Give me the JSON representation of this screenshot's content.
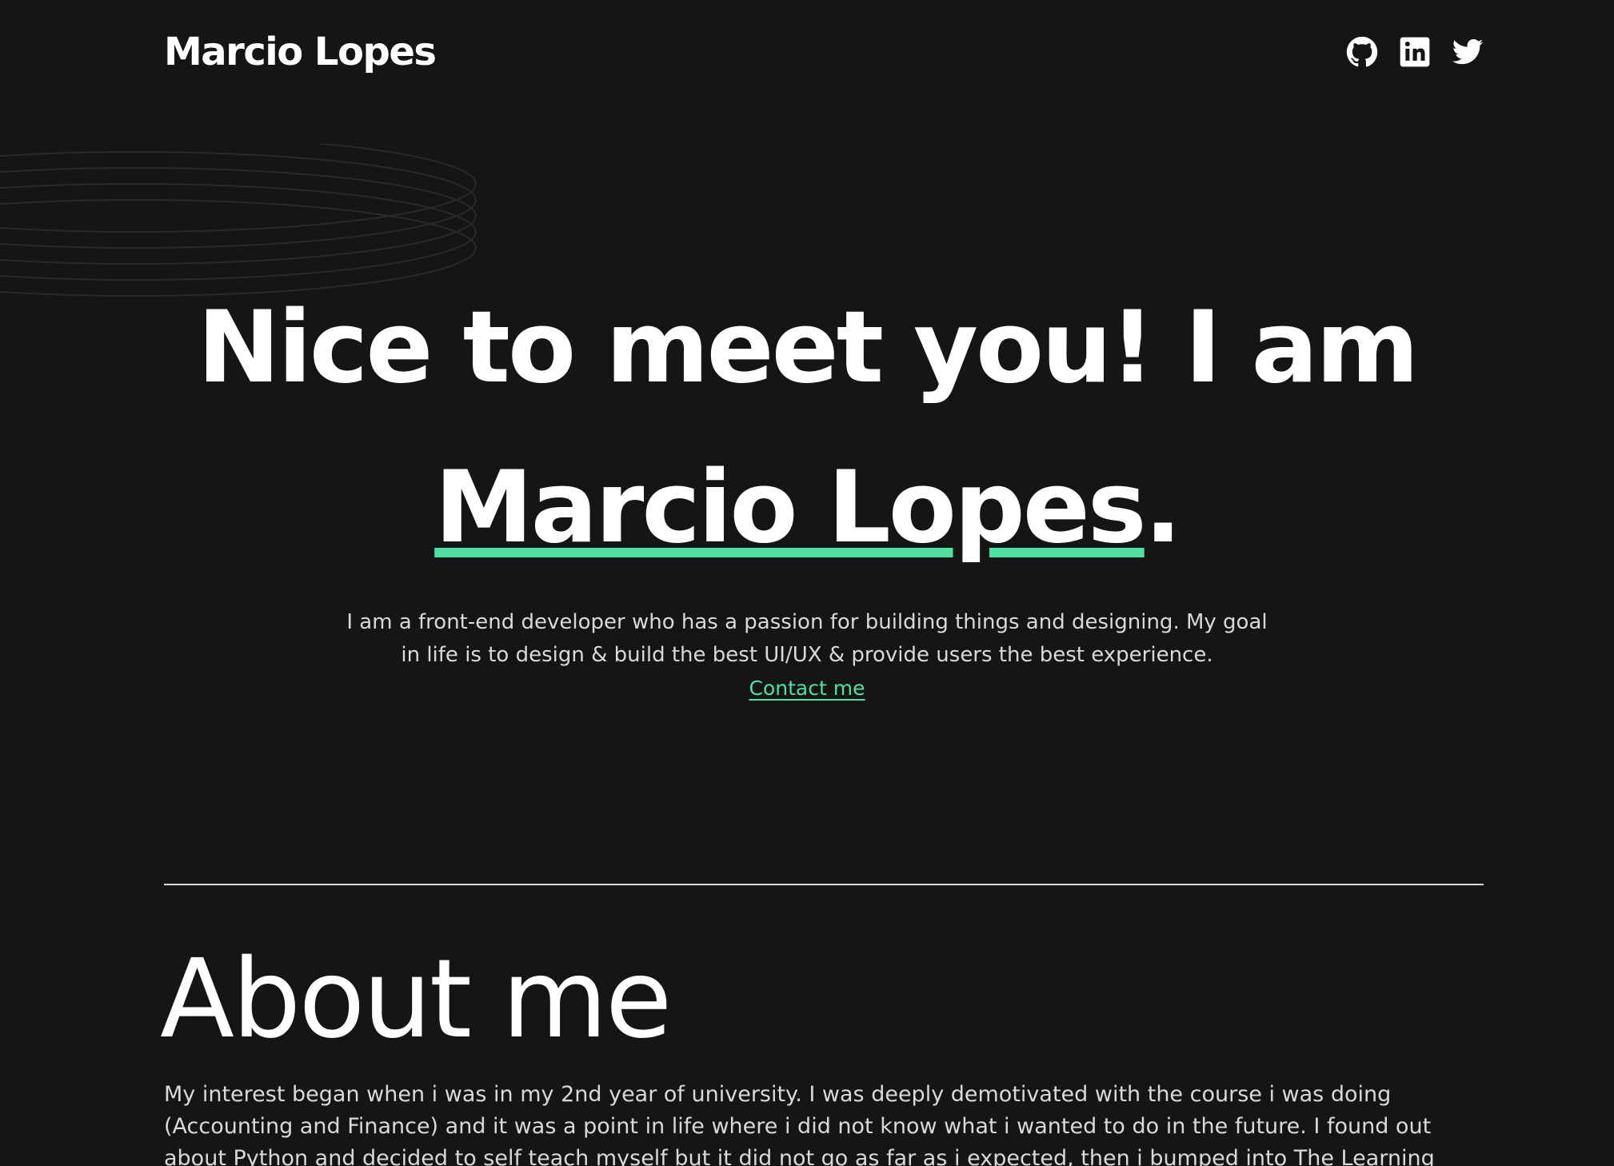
{
  "header": {
    "brand": "Marcio Lopes",
    "socials": [
      {
        "icon": "github-icon"
      },
      {
        "icon": "linkedin-icon"
      },
      {
        "icon": "twitter-icon"
      }
    ]
  },
  "hero": {
    "title_line1": "Nice to meet you! I am",
    "name": "Marcio Lopes",
    "name_suffix": ".",
    "intro_line1": "I am a front-end developer who has a passion for building things and designing. My goal",
    "intro_line2": "in life is to design & build the best UI/UX & provide users the best experience.",
    "contact_label": "Contact me"
  },
  "about": {
    "title": "About me",
    "text": "My interest began when i was in my 2nd year of university. I was deeply demotivated with the course i was doing (Accounting and Finance) and it was a point in life where i did not know what i wanted to do in the future. I found out about Python and decided to self teach myself but it did not go as far as i expected, then i bumped into The Learning People who gave me a"
  },
  "colors": {
    "background": "#151515",
    "accent": "#4ee1a0",
    "text": "#ffffff",
    "muted_text": "#d9d9d9"
  }
}
